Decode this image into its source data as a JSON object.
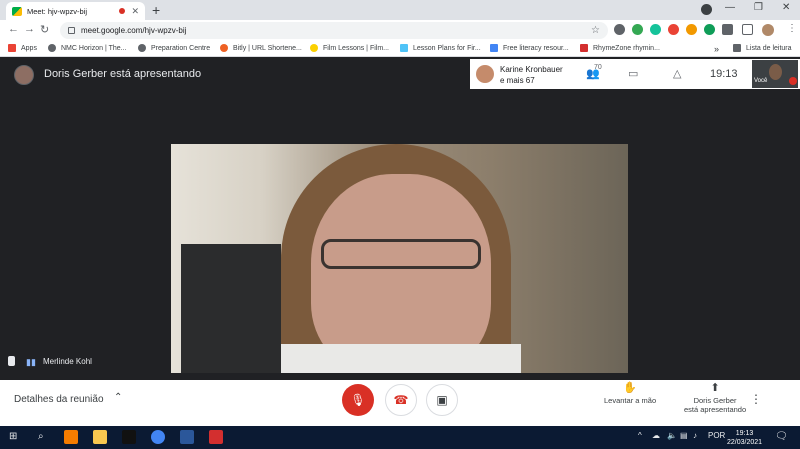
{
  "browser": {
    "tab_title": "Meet: hjv-wpzv-bij",
    "tab_close": "✕",
    "new_tab": "+",
    "url": "meet.google.com/hjv-wpzv-bij",
    "bookmarks": [
      "Apps",
      "NMC Horizon | The...",
      "Preparation Centre",
      "Bitly | URL Shortene...",
      "Film Lessons | Film...",
      "Lesson Plans for Fir...",
      "Free literacy resour...",
      "RhymeZone rhymin..."
    ],
    "more_bookmarks": "»",
    "reading_list": "Lista de leitura",
    "colors": {
      "tab_strip": "#dee1e6",
      "toolbar": "#ffffff"
    }
  },
  "meet": {
    "presenter_label": "Doris Gerber está apresentando",
    "topbar_name_line1": "Karine Kronbauer",
    "topbar_name_line2": "e mais 67",
    "participant_count": "70",
    "clock": "19:13",
    "self_label": "Você",
    "active_speaker_name": "Merlinde Kohl",
    "controls": {
      "details": "Detalhes da reunião",
      "raise_hand": "Levantar a mão",
      "presenting_line1": "Doris Gerber",
      "presenting_line2": "está apresentando"
    },
    "colors": {
      "background": "#202124",
      "end_call": "#d93025",
      "accent": "#8ab4f8"
    }
  },
  "taskbar": {
    "lang": "POR",
    "time": "19:13",
    "date": "22/03/2021"
  }
}
